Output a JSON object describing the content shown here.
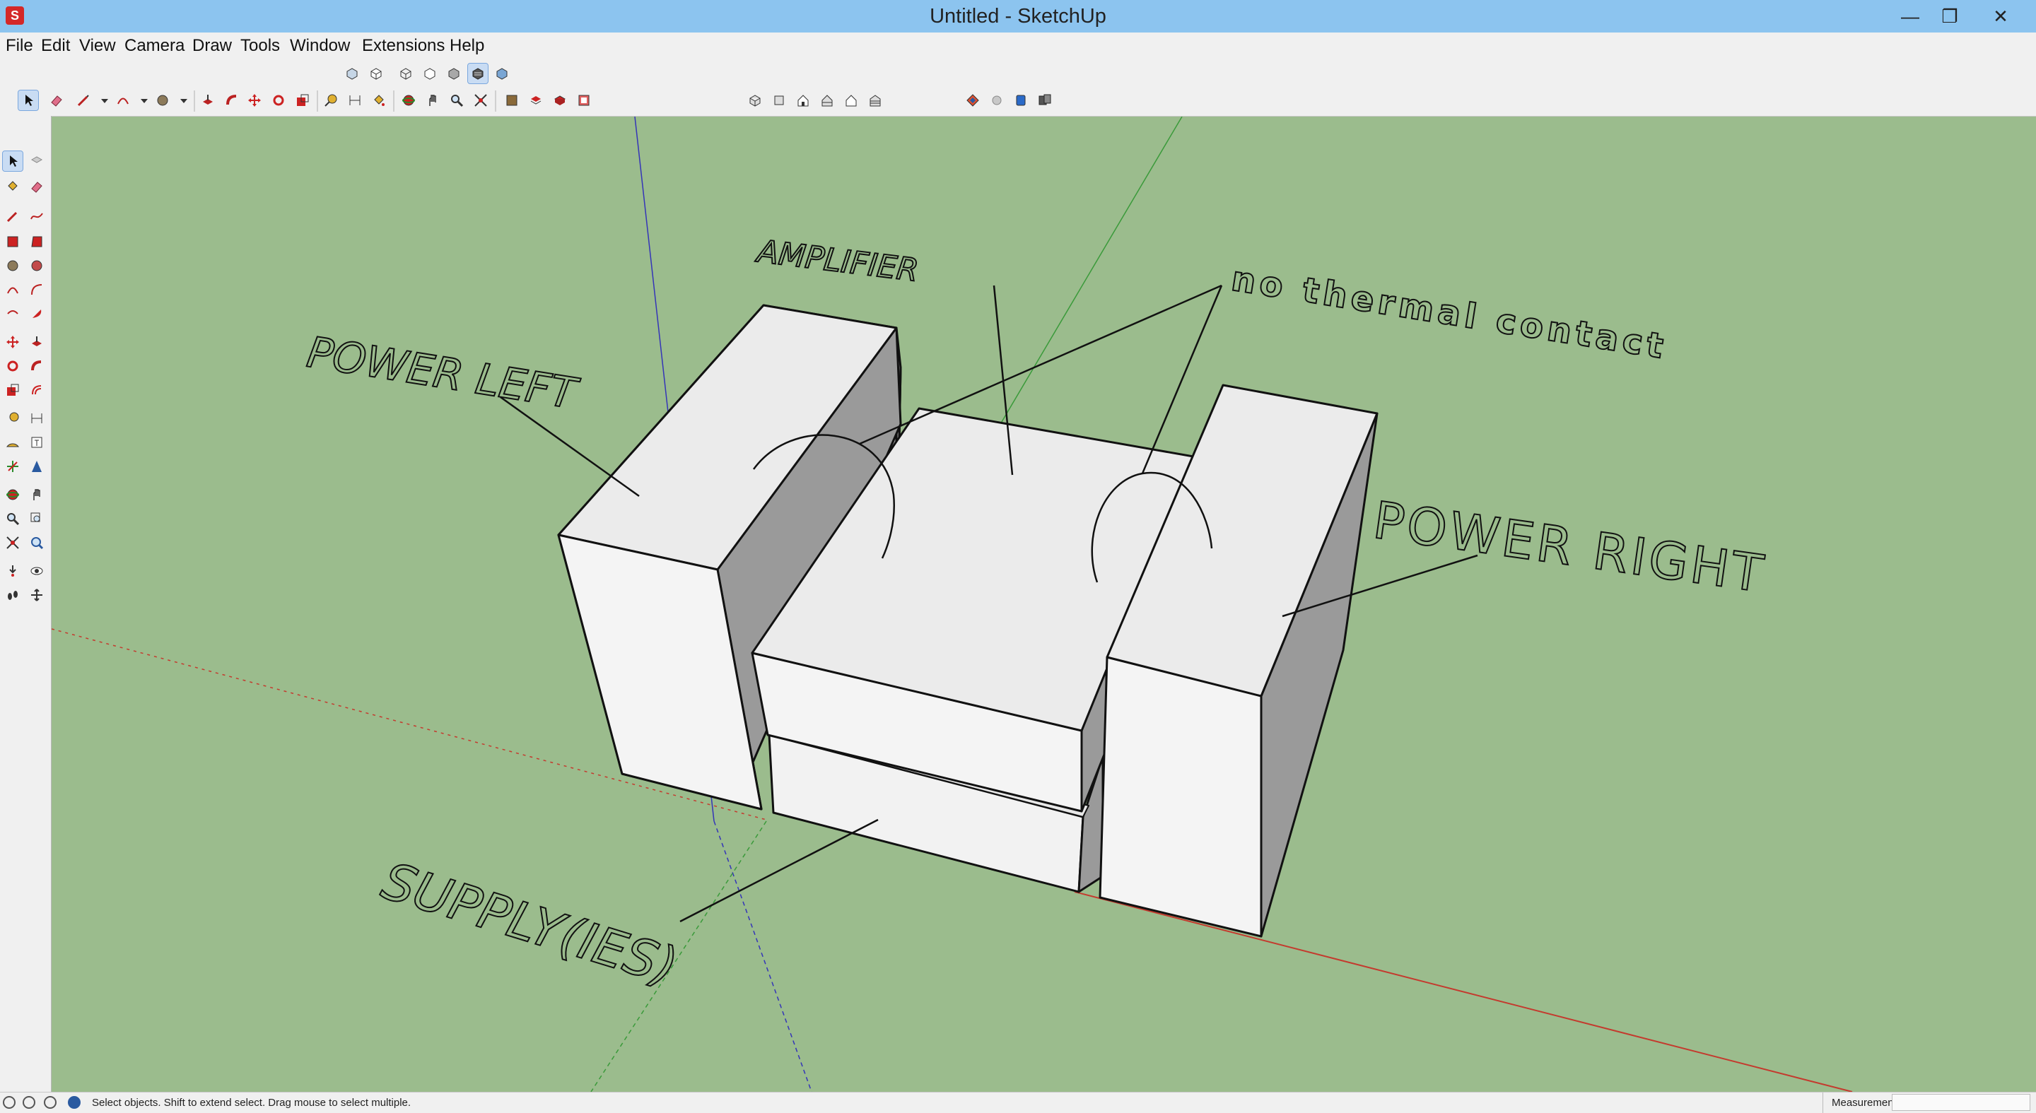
{
  "window": {
    "title": "Untitled - SketchUp",
    "controls": {
      "minimize": "—",
      "restore": "❐",
      "close": "✕"
    }
  },
  "menu": [
    "File",
    "Edit",
    "View",
    "Camera",
    "Draw",
    "Tools",
    "Window",
    "Extensions",
    "Help"
  ],
  "toolbars": {
    "views": [
      "iso-view",
      "top-view",
      "front-view",
      "right-view",
      "back-view",
      "left-view"
    ],
    "extras": [
      "extension-warehouse",
      "components",
      "3d-warehouse",
      "layout"
    ]
  },
  "scene": {
    "labels": {
      "amplifier": "AMPLIFIER",
      "power_left": "POWER LEFT",
      "power_right": "POWER RIGHT",
      "no_thermal": "no thermal contact",
      "supply": "SUPPLY(IES)"
    },
    "colors": {
      "ground": "#9bbc8d",
      "face_top": "#ebebeb",
      "face_front": "#f4f4f4",
      "face_side": "#9a9a9a",
      "axis_red": "#c43a2e",
      "axis_green": "#3a9a3a",
      "axis_blue": "#3434b8"
    }
  },
  "status": {
    "hint": "Select objects. Shift to extend select. Drag mouse to select multiple.",
    "measurements_label": "Measurements",
    "measurements_value": ""
  }
}
